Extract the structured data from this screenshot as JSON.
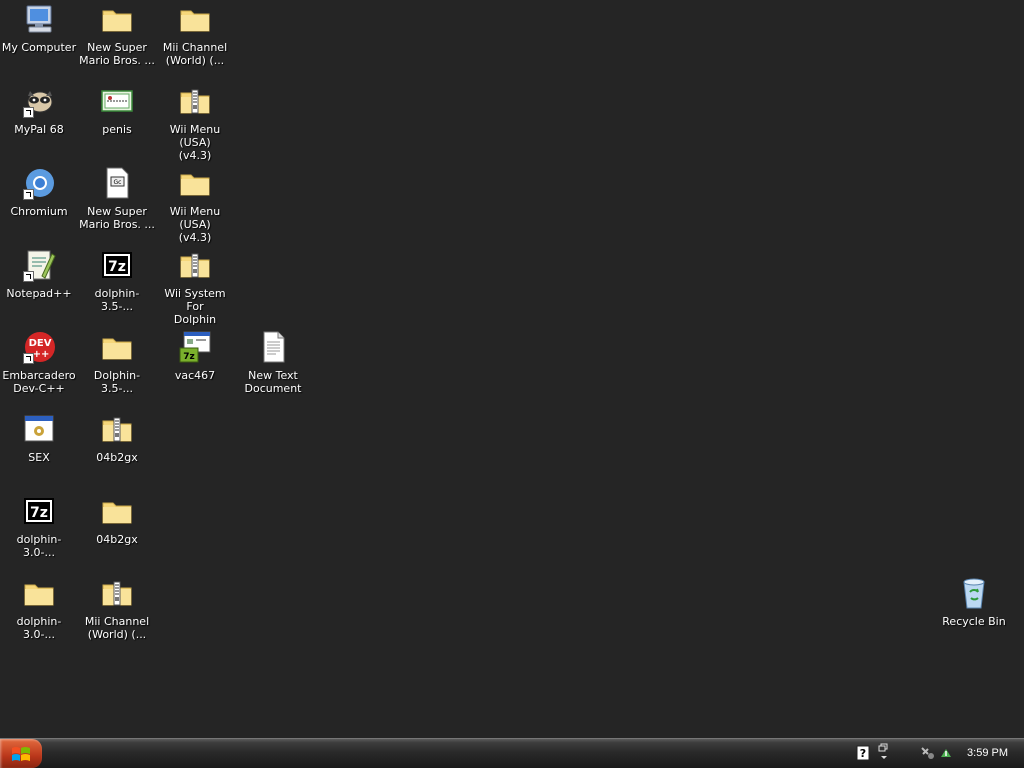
{
  "desktop": {
    "icons": {
      "my_computer": "My Computer",
      "nsmb_folder": "New Super\nMario Bros. ...",
      "mii_channel_folder": "Mii Channel\n(World) (...",
      "mypal": "MyPal 68",
      "penis": "penis",
      "wii_menu_zip": "Wii Menu (USA)\n(v4.3)",
      "chromium": "Chromium",
      "nsmb_file": "New Super\nMario Bros. ...",
      "wii_menu_folder": "Wii Menu (USA)\n(v4.3)",
      "notepadpp": "Notepad++",
      "dolphin35_7z": "dolphin-3.5-...",
      "wii_system_zip": "Wii System For\nDolphin",
      "devcpp": "Embarcadero\nDev-C++",
      "dolphin35_folder": "Dolphin-3.5-...",
      "vac467": "vac467",
      "new_text_doc": "New Text\nDocument",
      "sex": "SEX",
      "zip_04b2gx": "04b2gx",
      "dolphin30_7z": "dolphin-3.0-...",
      "folder_04b2gx": "04b2gx",
      "dolphin30_folder": "dolphin-3.0-...",
      "mii_channel_zip": "Mii Channel\n(World) (...",
      "recycle_bin": "Recycle Bin"
    }
  },
  "taskbar": {
    "start_logo": "windows-logo-icon",
    "clock": "3:59 PM"
  },
  "colors": {
    "desktop_bg": "#252525",
    "taskbar": "#2a2a2a",
    "start_button": "#c0441f",
    "folder": "#f6d77a",
    "label_text": "#ffffff"
  }
}
